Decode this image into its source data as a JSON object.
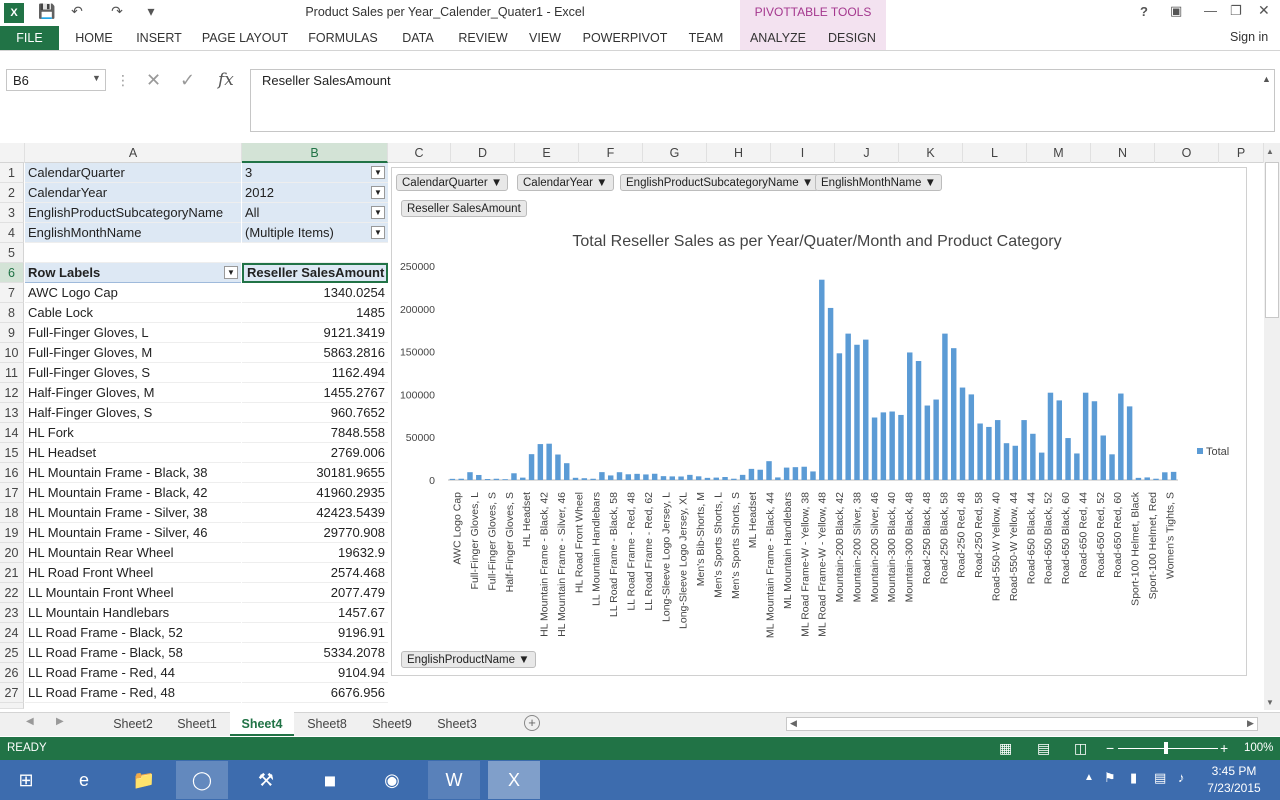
{
  "window": {
    "title": "Product Sales per Year_Calender_Quater1 - Excel",
    "pivot_tools": "PIVOTTABLE TOOLS",
    "help": "?",
    "sign_in": "Sign in"
  },
  "ribbon": {
    "tabs": [
      "FILE",
      "HOME",
      "INSERT",
      "PAGE LAYOUT",
      "FORMULAS",
      "DATA",
      "REVIEW",
      "VIEW",
      "POWERPIVOT",
      "TEAM",
      "ANALYZE",
      "DESIGN"
    ]
  },
  "formula": {
    "namebox": "B6",
    "fx": "fx",
    "content": "Reseller SalesAmount"
  },
  "columns": [
    "A",
    "B",
    "C",
    "D",
    "E",
    "F",
    "G",
    "H",
    "I",
    "J",
    "K",
    "L",
    "M",
    "N",
    "O",
    "P"
  ],
  "filters": [
    {
      "row": "1",
      "field": "CalendarQuarter",
      "value": "3"
    },
    {
      "row": "2",
      "field": "CalendarYear",
      "value": "2012"
    },
    {
      "row": "3",
      "field": "EnglishProductSubcategoryName",
      "value": "All"
    },
    {
      "row": "4",
      "field": "EnglishMonthName",
      "value": "(Multiple Items)"
    }
  ],
  "pivot": {
    "row_label_header": "Row Labels",
    "value_header": "Reseller SalesAmount",
    "rows": [
      [
        "7",
        "AWC Logo Cap",
        "1340.0254"
      ],
      [
        "8",
        "Cable Lock",
        "1485"
      ],
      [
        "9",
        "Full-Finger Gloves, L",
        "9121.3419"
      ],
      [
        "10",
        "Full-Finger Gloves, M",
        "5863.2816"
      ],
      [
        "11",
        "Full-Finger Gloves, S",
        "1162.494"
      ],
      [
        "12",
        "Half-Finger Gloves, M",
        "1455.2767"
      ],
      [
        "13",
        "Half-Finger Gloves, S",
        "960.7652"
      ],
      [
        "14",
        "HL Fork",
        "7848.558"
      ],
      [
        "15",
        "HL Headset",
        "2769.006"
      ],
      [
        "16",
        "HL Mountain Frame - Black, 38",
        "30181.9655"
      ],
      [
        "17",
        "HL Mountain Frame - Black, 42",
        "41960.2935"
      ],
      [
        "18",
        "HL Mountain Frame - Silver, 38",
        "42423.5439"
      ],
      [
        "19",
        "HL Mountain Frame - Silver, 46",
        "29770.908"
      ],
      [
        "20",
        "HL Mountain Rear Wheel",
        "19632.9"
      ],
      [
        "21",
        "HL Road Front Wheel",
        "2574.468"
      ],
      [
        "22",
        "LL Mountain Front Wheel",
        "2077.479"
      ],
      [
        "23",
        "LL Mountain Handlebars",
        "1457.67"
      ],
      [
        "24",
        "LL Road Frame - Black, 52",
        "9196.91"
      ],
      [
        "25",
        "LL Road Frame - Black, 58",
        "5334.2078"
      ],
      [
        "26",
        "LL Road Frame - Red, 44",
        "9104.94"
      ],
      [
        "27",
        "LL Road Frame - Red, 48",
        "6676.956"
      ]
    ]
  },
  "chart_buttons": {
    "filters": [
      "CalendarQuarter",
      "CalendarYear",
      "EnglishProductSubcategoryName",
      "EnglishMonthName"
    ],
    "values": "Reseller SalesAmount",
    "axis": "EnglishProductName"
  },
  "chart_data": {
    "type": "bar",
    "title": "Total Reseller Sales as per Year/Quater/Month and Product Category",
    "legend": "Total",
    "legend_position": "right",
    "ylim": [
      0,
      250000
    ],
    "yticks": [
      "0",
      "50000",
      "100000",
      "150000",
      "200000",
      "250000"
    ],
    "grid": false,
    "labels": [
      "AWC Logo Cap",
      "Full-Finger Gloves, L",
      "Full-Finger Gloves, S",
      "Half-Finger Gloves, S",
      "HL Headset",
      "HL Mountain Frame - Black, 42",
      "HL Mountain Frame - Silver, 46",
      "HL Road Front Wheel",
      "LL Mountain Handlebars",
      "LL Road Frame - Black, 58",
      "LL Road Frame - Red, 48",
      "LL Road Frame - Red, 62",
      "Long-Sleeve Logo Jersey, L",
      "Long-Sleeve Logo Jersey, XL",
      "Men's Bib-Shorts, M",
      "Men's Sports Shorts, L",
      "Men's Sports Shorts, S",
      "ML Headset",
      "ML Mountain Frame - Black, 44",
      "ML Mountain Handlebars",
      "ML Road Frame-W - Yellow, 38",
      "ML Road Frame-W - Yellow, 48",
      "Mountain-200 Black, 42",
      "Mountain-200 Silver, 38",
      "Mountain-200 Silver, 46",
      "Mountain-300 Black, 40",
      "Mountain-300 Black, 48",
      "Road-250 Black, 48",
      "Road-250 Black, 58",
      "Road-250 Red, 48",
      "Road-250 Red, 58",
      "Road-550-W Yellow, 40",
      "Road-550-W Yellow, 44",
      "Road-650 Black, 44",
      "Road-650 Black, 52",
      "Road-650 Black, 60",
      "Road-650 Red, 44",
      "Road-650 Red, 52",
      "Road-650 Red, 60",
      "Sport-100 Helmet, Black",
      "Sport-100 Helmet, Red",
      "Women's Tights, S"
    ],
    "values": [
      1340,
      1485,
      9121,
      5863,
      1162,
      1455,
      961,
      7849,
      2769,
      30182,
      41960,
      42424,
      29771,
      19633,
      2574,
      2077,
      1458,
      9197,
      5334,
      9105,
      6677,
      7200,
      6500,
      7300,
      4500,
      4200,
      4100,
      6000,
      4300,
      2500,
      2800,
      3500,
      1500,
      6000,
      13000,
      12000,
      22000,
      3000,
      14500,
      15000,
      15500,
      10000,
      234000,
      201000,
      148000,
      171000,
      158000,
      164000,
      73000,
      79000,
      80000,
      76000,
      149000,
      139000,
      87000,
      94000,
      171000,
      154000,
      108000,
      100000,
      66000,
      62000,
      70000,
      43000,
      40000,
      70000,
      54000,
      32000,
      102000,
      93000,
      49000,
      31000,
      102000,
      92000,
      52000,
      30000,
      101000,
      86000,
      2500,
      3000,
      1500,
      9000,
      9500
    ]
  },
  "sheets": {
    "tabs": [
      "Sheet2",
      "Sheet1",
      "Sheet4",
      "Sheet8",
      "Sheet9",
      "Sheet3"
    ],
    "active": "Sheet4"
  },
  "status": {
    "text": "READY",
    "zoom": "100%"
  },
  "taskbar": {
    "time": "3:45 PM",
    "date": "7/23/2015"
  }
}
